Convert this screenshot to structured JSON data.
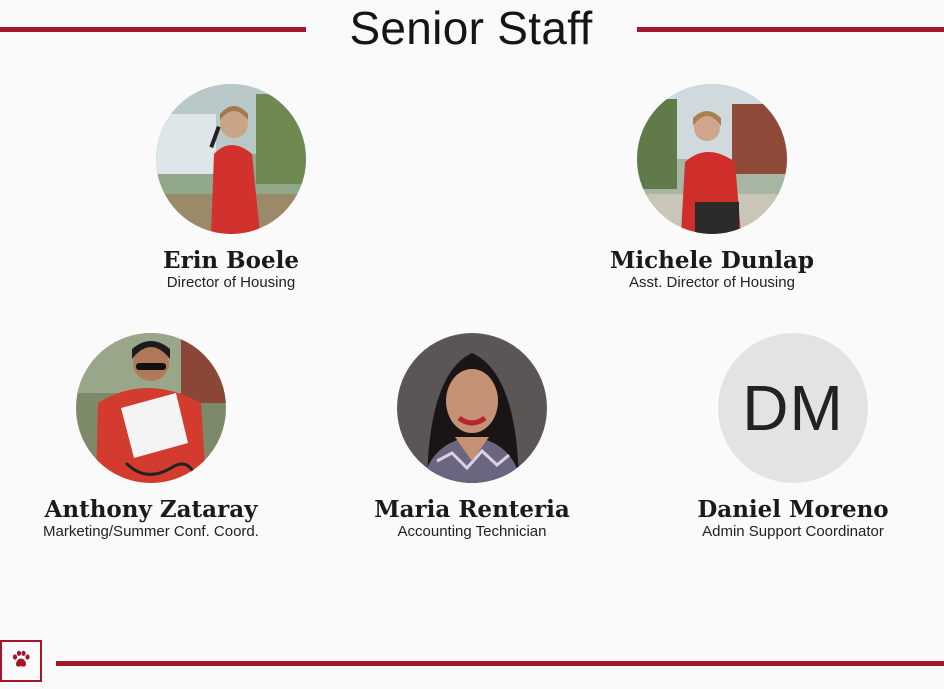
{
  "heading": {
    "title": "Senior Staff"
  },
  "colors": {
    "accent": "#a3162c",
    "background": "#fafafa",
    "placeholder_avatar": "#e3e3e3"
  },
  "staff": [
    {
      "name": "Erin Boele",
      "role": "Director of Housing",
      "avatar": "photo"
    },
    {
      "name": "Michele Dunlap",
      "role": "Asst. Director of Housing",
      "avatar": "photo"
    },
    {
      "name": "Anthony Zataray",
      "role": "Marketing/Summer Conf. Coord.",
      "avatar": "photo"
    },
    {
      "name": "Maria Renteria",
      "role": "Accounting Technician",
      "avatar": "photo"
    },
    {
      "name": "Daniel Moreno",
      "role": "Admin Support Coordinator",
      "avatar": "initials",
      "initials": "DM"
    }
  ],
  "footer": {
    "icon": "paw-icon"
  }
}
